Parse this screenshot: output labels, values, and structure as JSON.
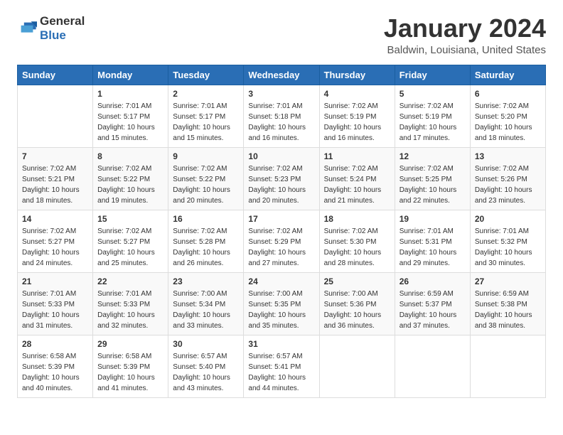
{
  "logo": {
    "general": "General",
    "blue": "Blue"
  },
  "header": {
    "title": "January 2024",
    "subtitle": "Baldwin, Louisiana, United States"
  },
  "days_of_week": [
    "Sunday",
    "Monday",
    "Tuesday",
    "Wednesday",
    "Thursday",
    "Friday",
    "Saturday"
  ],
  "weeks": [
    [
      {
        "day": "",
        "info": ""
      },
      {
        "day": "1",
        "info": "Sunrise: 7:01 AM\nSunset: 5:17 PM\nDaylight: 10 hours\nand 15 minutes."
      },
      {
        "day": "2",
        "info": "Sunrise: 7:01 AM\nSunset: 5:17 PM\nDaylight: 10 hours\nand 15 minutes."
      },
      {
        "day": "3",
        "info": "Sunrise: 7:01 AM\nSunset: 5:18 PM\nDaylight: 10 hours\nand 16 minutes."
      },
      {
        "day": "4",
        "info": "Sunrise: 7:02 AM\nSunset: 5:19 PM\nDaylight: 10 hours\nand 16 minutes."
      },
      {
        "day": "5",
        "info": "Sunrise: 7:02 AM\nSunset: 5:19 PM\nDaylight: 10 hours\nand 17 minutes."
      },
      {
        "day": "6",
        "info": "Sunrise: 7:02 AM\nSunset: 5:20 PM\nDaylight: 10 hours\nand 18 minutes."
      }
    ],
    [
      {
        "day": "7",
        "info": "Sunrise: 7:02 AM\nSunset: 5:21 PM\nDaylight: 10 hours\nand 18 minutes."
      },
      {
        "day": "8",
        "info": "Sunrise: 7:02 AM\nSunset: 5:22 PM\nDaylight: 10 hours\nand 19 minutes."
      },
      {
        "day": "9",
        "info": "Sunrise: 7:02 AM\nSunset: 5:22 PM\nDaylight: 10 hours\nand 20 minutes."
      },
      {
        "day": "10",
        "info": "Sunrise: 7:02 AM\nSunset: 5:23 PM\nDaylight: 10 hours\nand 20 minutes."
      },
      {
        "day": "11",
        "info": "Sunrise: 7:02 AM\nSunset: 5:24 PM\nDaylight: 10 hours\nand 21 minutes."
      },
      {
        "day": "12",
        "info": "Sunrise: 7:02 AM\nSunset: 5:25 PM\nDaylight: 10 hours\nand 22 minutes."
      },
      {
        "day": "13",
        "info": "Sunrise: 7:02 AM\nSunset: 5:26 PM\nDaylight: 10 hours\nand 23 minutes."
      }
    ],
    [
      {
        "day": "14",
        "info": "Sunrise: 7:02 AM\nSunset: 5:27 PM\nDaylight: 10 hours\nand 24 minutes."
      },
      {
        "day": "15",
        "info": "Sunrise: 7:02 AM\nSunset: 5:27 PM\nDaylight: 10 hours\nand 25 minutes."
      },
      {
        "day": "16",
        "info": "Sunrise: 7:02 AM\nSunset: 5:28 PM\nDaylight: 10 hours\nand 26 minutes."
      },
      {
        "day": "17",
        "info": "Sunrise: 7:02 AM\nSunset: 5:29 PM\nDaylight: 10 hours\nand 27 minutes."
      },
      {
        "day": "18",
        "info": "Sunrise: 7:02 AM\nSunset: 5:30 PM\nDaylight: 10 hours\nand 28 minutes."
      },
      {
        "day": "19",
        "info": "Sunrise: 7:01 AM\nSunset: 5:31 PM\nDaylight: 10 hours\nand 29 minutes."
      },
      {
        "day": "20",
        "info": "Sunrise: 7:01 AM\nSunset: 5:32 PM\nDaylight: 10 hours\nand 30 minutes."
      }
    ],
    [
      {
        "day": "21",
        "info": "Sunrise: 7:01 AM\nSunset: 5:33 PM\nDaylight: 10 hours\nand 31 minutes."
      },
      {
        "day": "22",
        "info": "Sunrise: 7:01 AM\nSunset: 5:33 PM\nDaylight: 10 hours\nand 32 minutes."
      },
      {
        "day": "23",
        "info": "Sunrise: 7:00 AM\nSunset: 5:34 PM\nDaylight: 10 hours\nand 33 minutes."
      },
      {
        "day": "24",
        "info": "Sunrise: 7:00 AM\nSunset: 5:35 PM\nDaylight: 10 hours\nand 35 minutes."
      },
      {
        "day": "25",
        "info": "Sunrise: 7:00 AM\nSunset: 5:36 PM\nDaylight: 10 hours\nand 36 minutes."
      },
      {
        "day": "26",
        "info": "Sunrise: 6:59 AM\nSunset: 5:37 PM\nDaylight: 10 hours\nand 37 minutes."
      },
      {
        "day": "27",
        "info": "Sunrise: 6:59 AM\nSunset: 5:38 PM\nDaylight: 10 hours\nand 38 minutes."
      }
    ],
    [
      {
        "day": "28",
        "info": "Sunrise: 6:58 AM\nSunset: 5:39 PM\nDaylight: 10 hours\nand 40 minutes."
      },
      {
        "day": "29",
        "info": "Sunrise: 6:58 AM\nSunset: 5:39 PM\nDaylight: 10 hours\nand 41 minutes."
      },
      {
        "day": "30",
        "info": "Sunrise: 6:57 AM\nSunset: 5:40 PM\nDaylight: 10 hours\nand 43 minutes."
      },
      {
        "day": "31",
        "info": "Sunrise: 6:57 AM\nSunset: 5:41 PM\nDaylight: 10 hours\nand 44 minutes."
      },
      {
        "day": "",
        "info": ""
      },
      {
        "day": "",
        "info": ""
      },
      {
        "day": "",
        "info": ""
      }
    ]
  ]
}
